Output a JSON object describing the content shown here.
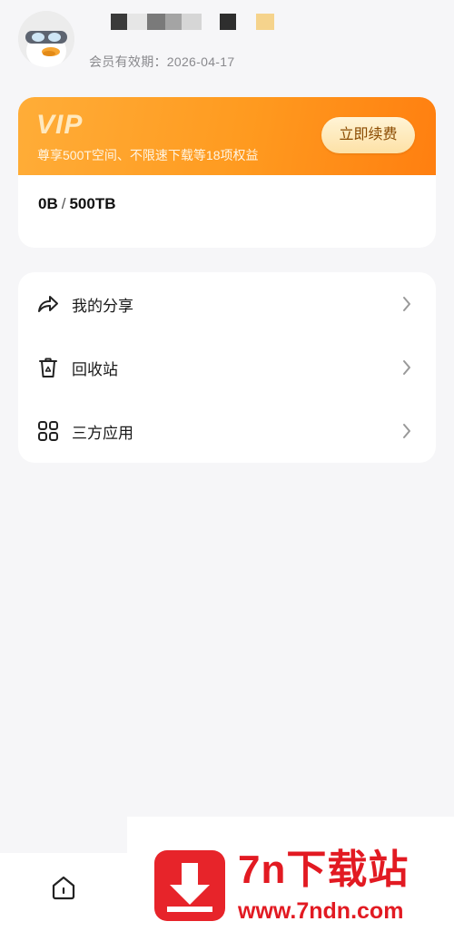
{
  "profile": {
    "avatar_icon": "duck-avatar",
    "membership_expiry": "会员有效期：2026-04-17"
  },
  "vip": {
    "title": "VIP",
    "description": "尊享500T空间、不限速下载等18项权益",
    "renew_label": "立即续费",
    "storage_used": "0B",
    "storage_separator": "/",
    "storage_total": "500TB",
    "banner_color": "#ff9a1f"
  },
  "menu": {
    "items": [
      {
        "label": "我的分享",
        "icon": "share-arrow-icon"
      },
      {
        "label": "回收站",
        "icon": "trash-recycle-icon"
      },
      {
        "label": "三方应用",
        "icon": "apps-grid-icon"
      }
    ]
  },
  "bottom_nav": {
    "home_icon": "home-icon"
  },
  "watermark": {
    "brand": "7n下载站",
    "url": "www.7ndn.com",
    "color": "#e21a22"
  }
}
